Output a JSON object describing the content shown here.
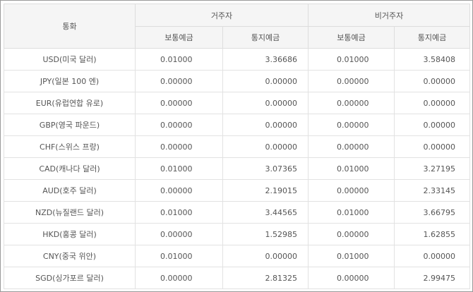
{
  "header": {
    "currency_label": "통화",
    "resident_label": "거주자",
    "nonresident_label": "비거주자",
    "ordinary_label": "보통예금",
    "term_label": "통지예금"
  },
  "rows": [
    {
      "currency": "USD(미국 달러)",
      "resident_ordinary": "0.01000",
      "resident_term": "3.36686",
      "nonresident_ordinary": "0.01000",
      "nonresident_term": "3.58408"
    },
    {
      "currency": "JPY(일본 100 엔)",
      "resident_ordinary": "0.00000",
      "resident_term": "0.00000",
      "nonresident_ordinary": "0.00000",
      "nonresident_term": "0.00000"
    },
    {
      "currency": "EUR(유럽연합 유로)",
      "resident_ordinary": "0.00000",
      "resident_term": "0.00000",
      "nonresident_ordinary": "0.00000",
      "nonresident_term": "0.00000"
    },
    {
      "currency": "GBP(영국 파운드)",
      "resident_ordinary": "0.00000",
      "resident_term": "0.00000",
      "nonresident_ordinary": "0.00000",
      "nonresident_term": "0.00000"
    },
    {
      "currency": "CHF(스위스 프랑)",
      "resident_ordinary": "0.00000",
      "resident_term": "0.00000",
      "nonresident_ordinary": "0.00000",
      "nonresident_term": "0.00000"
    },
    {
      "currency": "CAD(캐나다 달러)",
      "resident_ordinary": "0.01000",
      "resident_term": "3.07365",
      "nonresident_ordinary": "0.01000",
      "nonresident_term": "3.27195"
    },
    {
      "currency": "AUD(호주 달러)",
      "resident_ordinary": "0.00000",
      "resident_term": "2.19015",
      "nonresident_ordinary": "0.00000",
      "nonresident_term": "2.33145"
    },
    {
      "currency": "NZD(뉴질랜드 달러)",
      "resident_ordinary": "0.01000",
      "resident_term": "3.44565",
      "nonresident_ordinary": "0.01000",
      "nonresident_term": "3.66795"
    },
    {
      "currency": "HKD(홍콩 달러)",
      "resident_ordinary": "0.00000",
      "resident_term": "1.52985",
      "nonresident_ordinary": "0.00000",
      "nonresident_term": "1.62855"
    },
    {
      "currency": "CNY(중국 위안)",
      "resident_ordinary": "0.01000",
      "resident_term": "0.00000",
      "nonresident_ordinary": "0.01000",
      "nonresident_term": "0.00000"
    },
    {
      "currency": "SGD(싱가포르 달러)",
      "resident_ordinary": "0.00000",
      "resident_term": "2.81325",
      "nonresident_ordinary": "0.00000",
      "nonresident_term": "2.99475"
    }
  ]
}
